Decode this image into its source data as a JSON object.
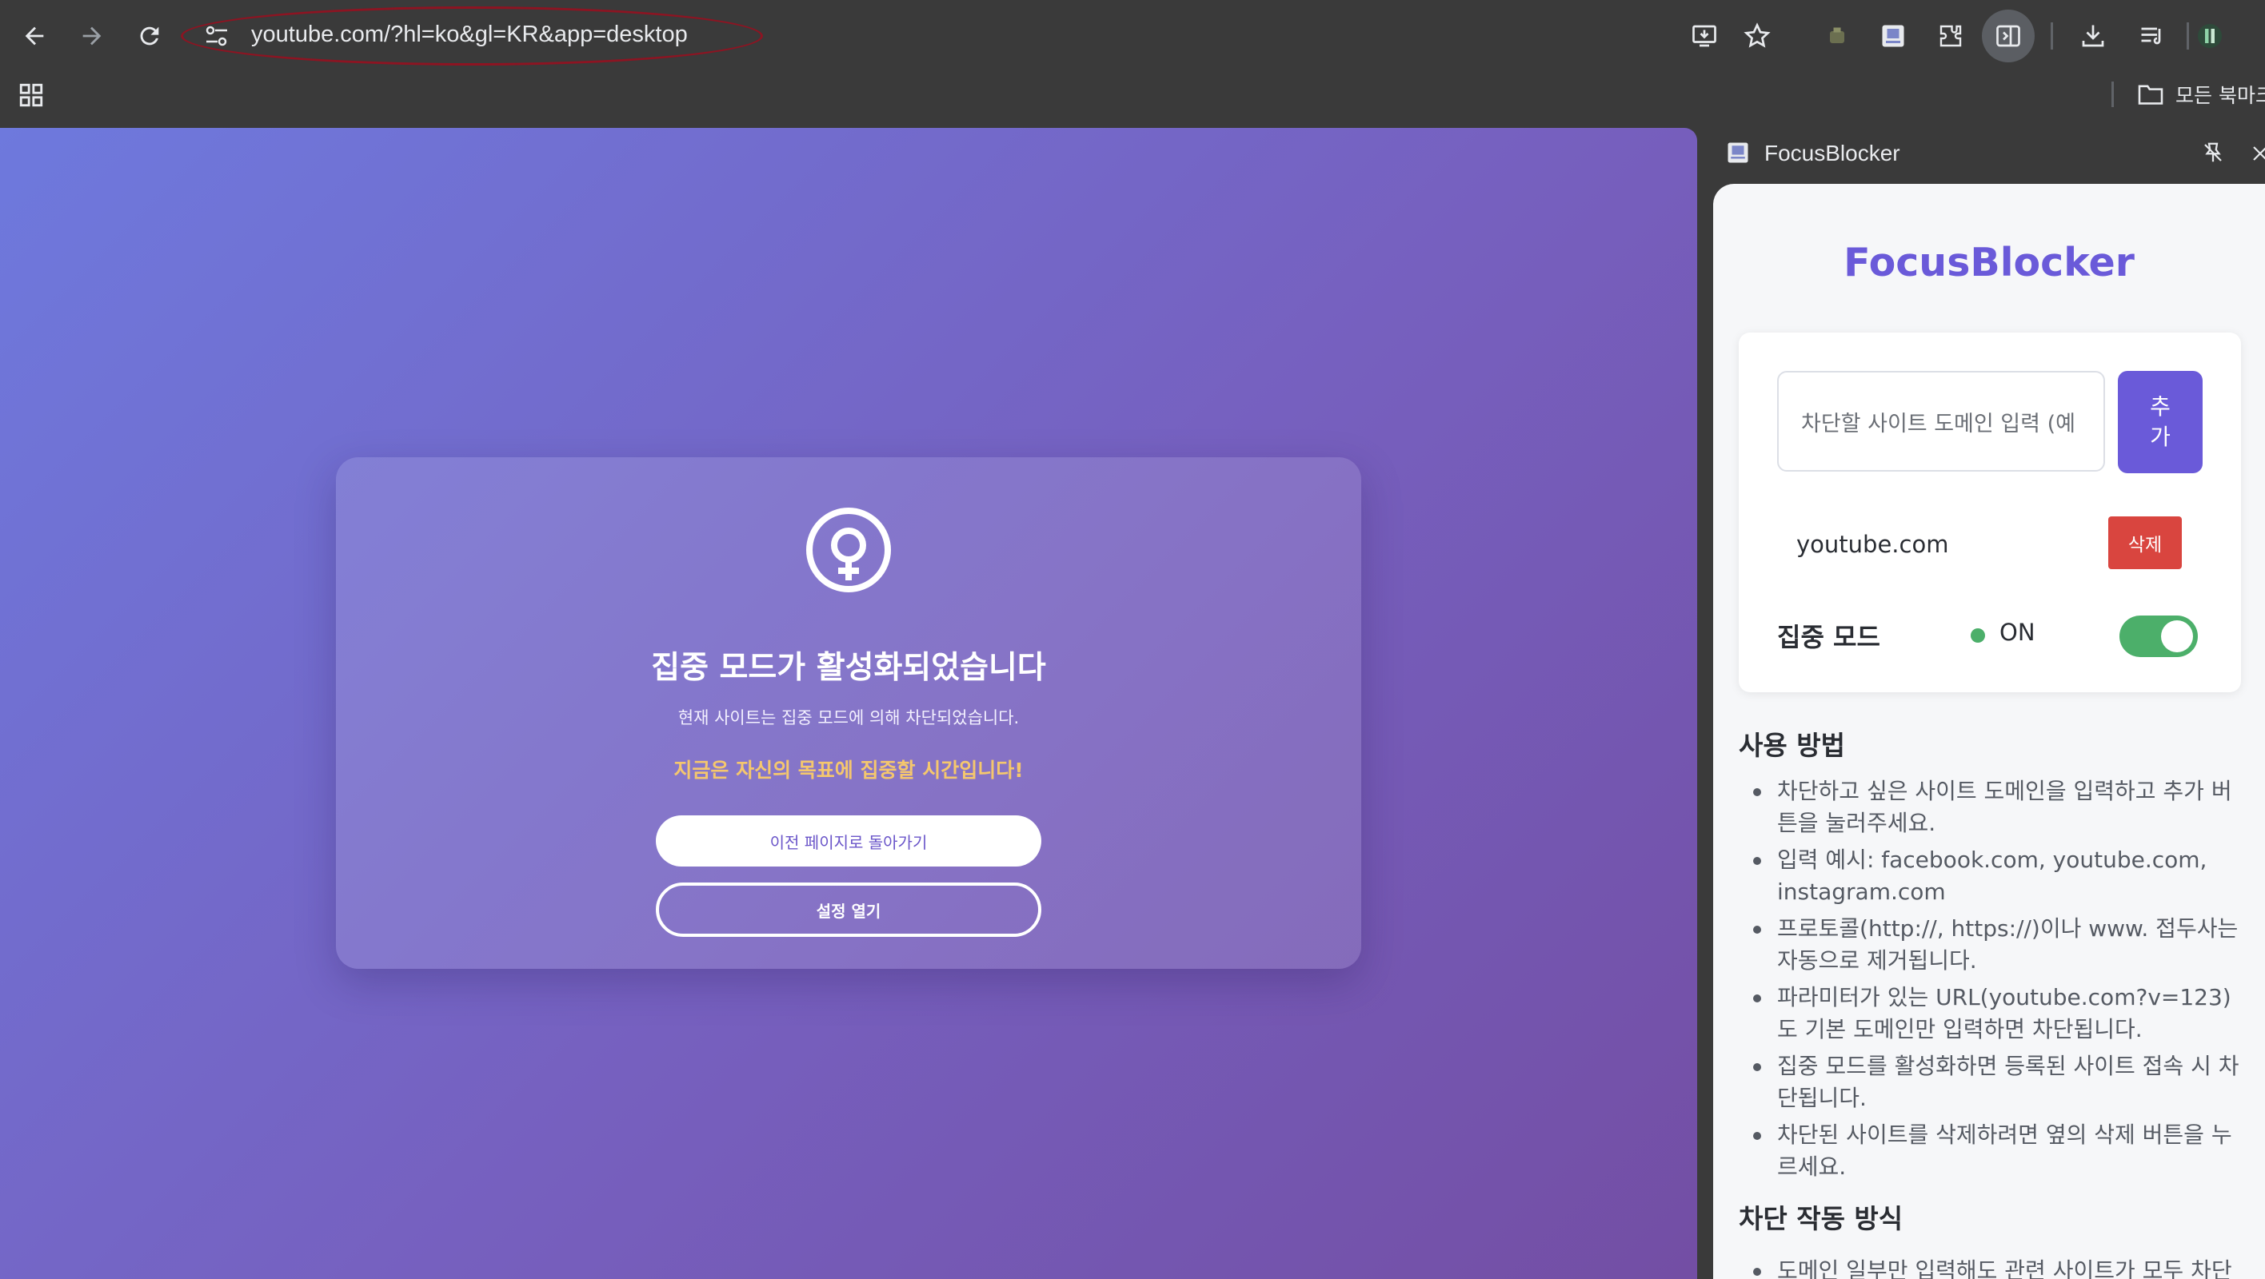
{
  "browser": {
    "address_bar": {
      "url": "youtube.com/?hl=ko&gl=KR&app=desktop"
    },
    "bookmarks_bar": {
      "all_bookmarks_label": "모든 북마크"
    },
    "icons": [
      "back-icon",
      "forward-icon",
      "reload-icon",
      "site-info-icon",
      "install-app-icon",
      "bookmark-star-icon",
      "extension-icon",
      "focusblocker-extension-icon",
      "extensions-puzzle-icon",
      "side-panel-icon",
      "download-icon",
      "reading-list-icon",
      "profile-avatar-icon",
      "apps-grid-icon",
      "folder-icon"
    ]
  },
  "blocked_page": {
    "title": "집중 모드가 활성화되었습니다",
    "description": "현재 사이트는 집중 모드에 의해 차단되었습니다.",
    "motto": "지금은 자신의 목표에 집중할 시간입니다!",
    "back_button": "이전 페이지로 돌아가기",
    "settings_button": "설정 열기",
    "colors": {
      "gradient_start": "#6e79dd",
      "gradient_end": "#734ea4",
      "motto": "#f5c76d"
    }
  },
  "side_panel": {
    "header_title": "FocusBlocker",
    "app_title": "FocusBlocker",
    "input_placeholder": "차단할 사이트 도메인 입력 (예",
    "add_button": "추\n가",
    "blocked_sites": [
      {
        "domain": "youtube.com",
        "delete_label": "삭제"
      }
    ],
    "focus_mode": {
      "label": "집중 모드",
      "status": "ON",
      "enabled": true
    },
    "usage": {
      "heading": "사용 방법",
      "items": [
        "차단하고 싶은 사이트 도메인을 입력하고 추가 버튼을 눌러주세요.",
        "입력 예시: facebook.com, youtube.com, instagram.com",
        "프로토콜(http://, https://)이나 www. 접두사는 자동으로 제거됩니다.",
        "파라미터가 있는 URL(youtube.com?v=123)도 기본 도메인만 입력하면 차단됩니다.",
        "집중 모드를 활성화하면 등록된 사이트 접속 시 차단됩니다.",
        "차단된 사이트를 삭제하려면 옆의 삭제 버튼을 누르세요."
      ]
    },
    "mechanism": {
      "heading": "차단 작동 방식",
      "items": [
        "도메인 일부만 입력해도 관련 사이트가 모두 차단"
      ]
    },
    "colors": {
      "accent": "#6a5ad9",
      "delete": "#d9453f",
      "toggle_on": "#4caf6a"
    }
  }
}
